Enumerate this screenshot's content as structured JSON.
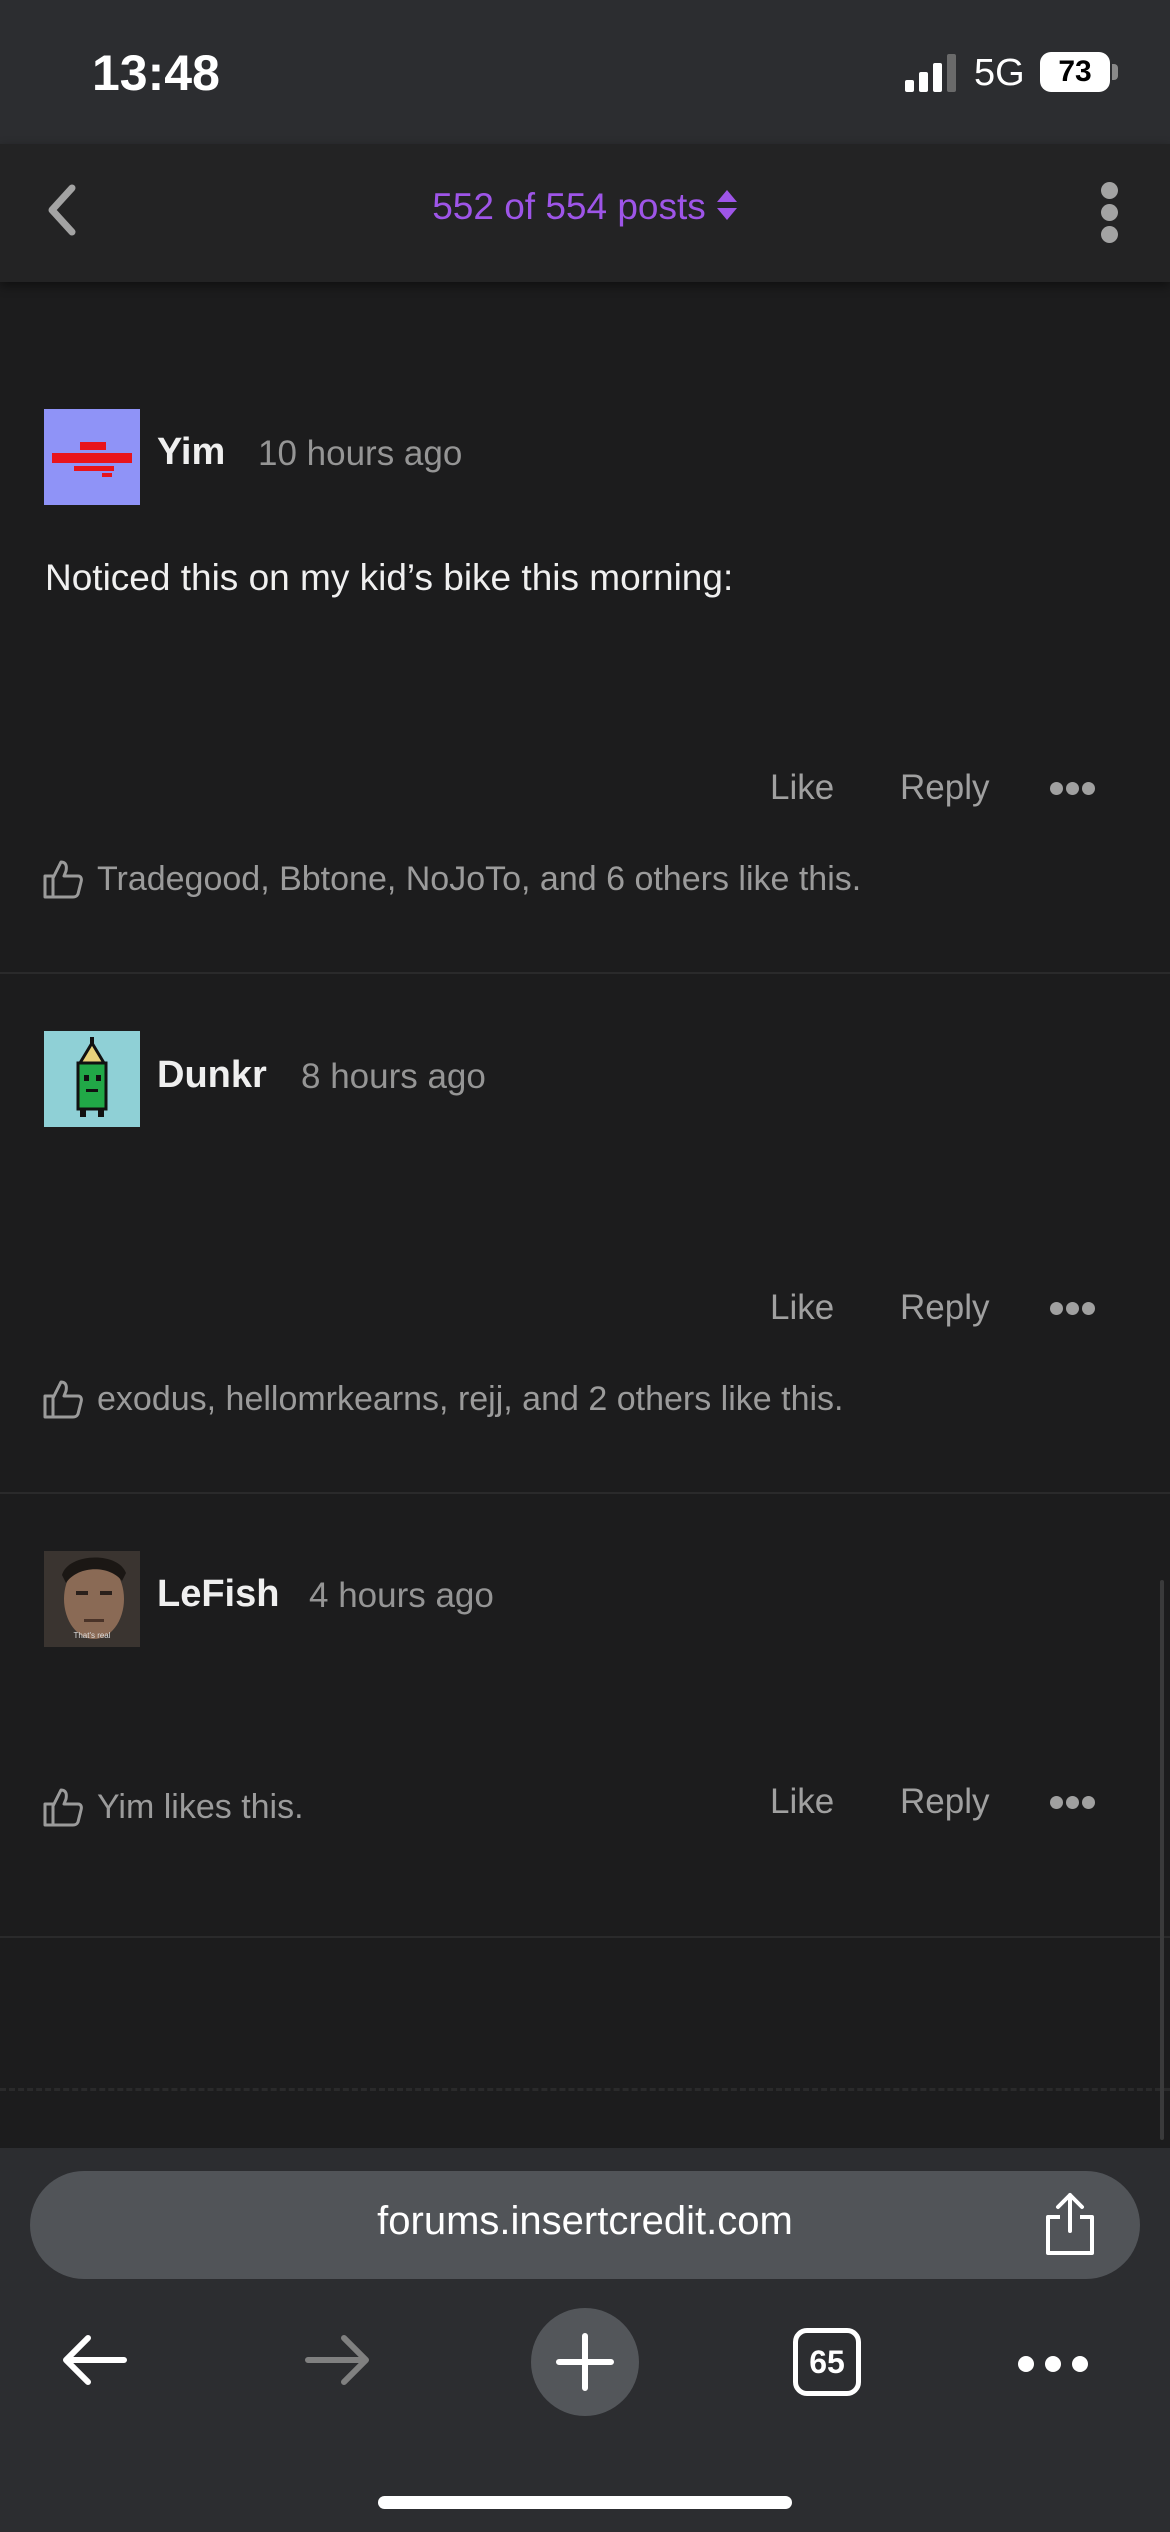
{
  "status_bar": {
    "time": "13:48",
    "network": "5G",
    "battery": "73"
  },
  "header": {
    "post_counter": "552 of 554 posts"
  },
  "posts": [
    {
      "username": "Yim",
      "timestamp": "10 hours ago",
      "body": "Noticed this on my kid’s bike this morning:",
      "like_label": "Like",
      "reply_label": "Reply",
      "likers": "Tradegood, Bbtone, NoJoTo, and 6 others like this."
    },
    {
      "username": "Dunkr",
      "timestamp": "8 hours ago",
      "body": "",
      "like_label": "Like",
      "reply_label": "Reply",
      "likers": "exodus, hellomrkearns, rejj, and 2 others like this."
    },
    {
      "username": "LeFish",
      "timestamp": "4 hours ago",
      "body": "",
      "like_label": "Like",
      "reply_label": "Reply",
      "likers": "Yim likes this.",
      "avatar_caption": "That's real"
    }
  ],
  "browser": {
    "url": "forums.insertcredit.com",
    "tab_count": "65"
  },
  "colors": {
    "accent": "#9e55e8",
    "background": "#1c1c1d",
    "toolbar": "#2c2d30"
  },
  "icons": [
    "back-chevron-icon",
    "sort-icon",
    "kebab-menu-icon",
    "thumbs-up-icon",
    "more-dots-icon",
    "share-icon",
    "back-arrow-icon",
    "forward-arrow-icon",
    "plus-icon",
    "tabs-icon",
    "more-icon"
  ]
}
